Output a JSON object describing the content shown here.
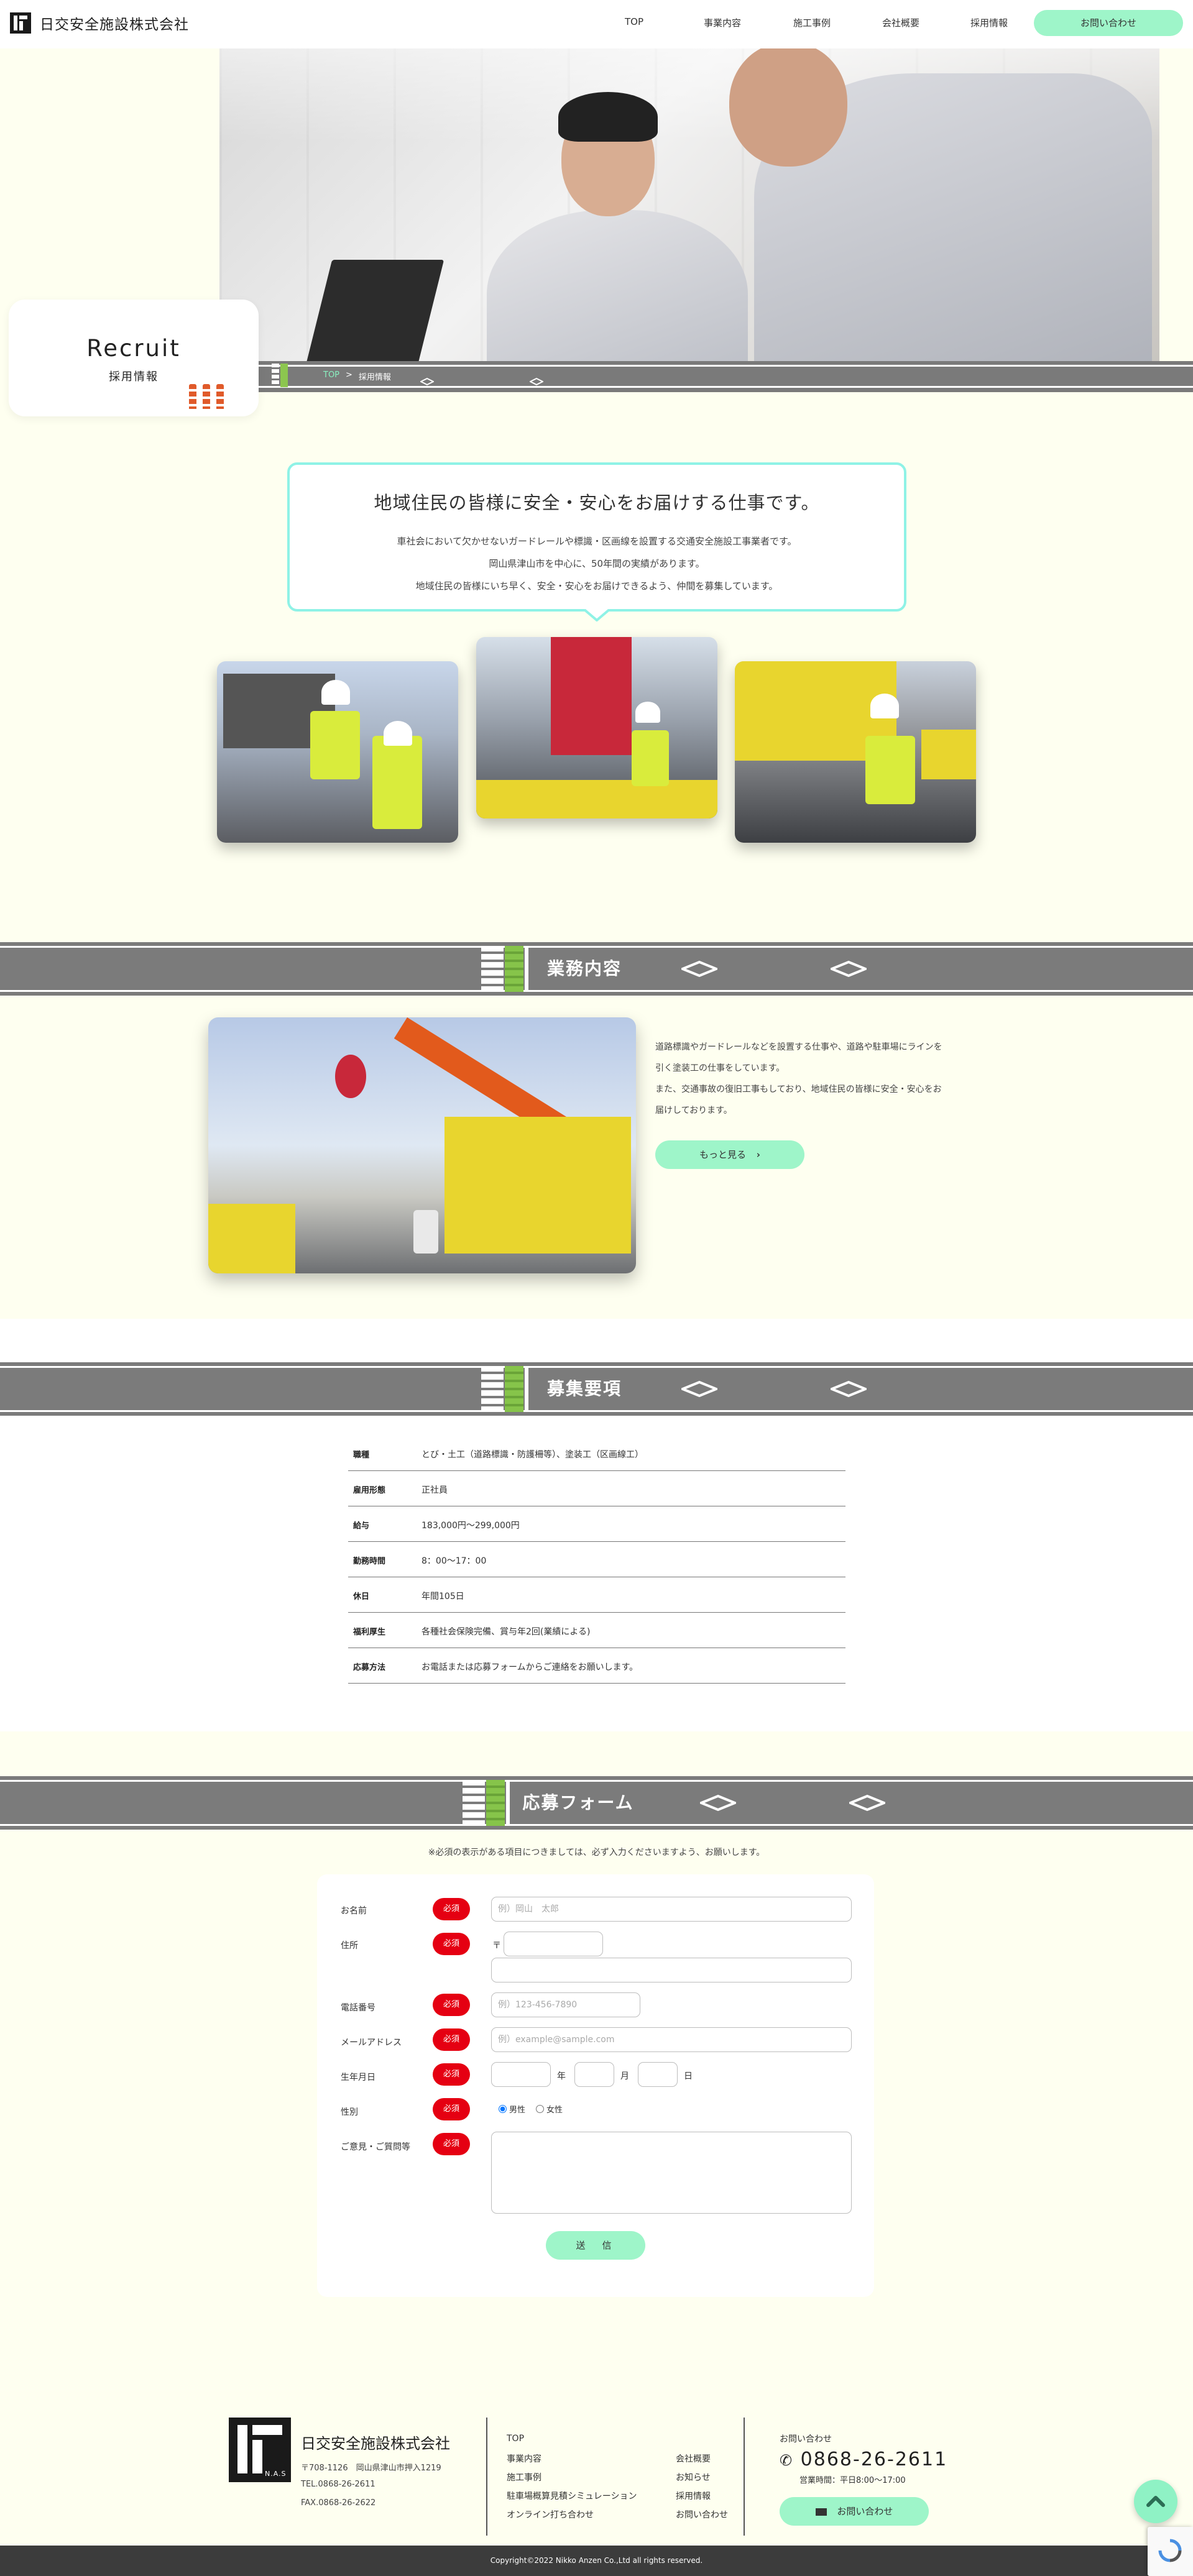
{
  "header": {
    "company": "日交安全施設株式会社",
    "nav": [
      "TOP",
      "事業内容",
      "施工事例",
      "会社概要",
      "採用情報"
    ],
    "contact_label": "お問い合わせ"
  },
  "hero": {
    "title_en": "Recruit",
    "title_jp": "採用情報",
    "breadcrumb_top": "TOP",
    "breadcrumb_sep": ">",
    "breadcrumb_current": "採用情報"
  },
  "intro": {
    "title": "地域住民の皆様に安全・安心をお届けする仕事です。",
    "lines": [
      "車社会において欠かせないガードレールや標識・区画線を設置する交通安全施設工事業者です。",
      "岡山県津山市を中心に、50年間の実績があります。",
      "地域住民の皆様にいち早く、安全・安心をお届けできるよう、仲間を募集しています。"
    ]
  },
  "business": {
    "heading": "業務内容",
    "text_lines": [
      "道路標識やガードレールなどを設置する仕事や、道路や駐車場にラインを",
      "引く塗装工の仕事をしています。",
      "また、交通事故の復旧工事もしており、地域住民の皆様に安全・安心をお",
      "届けしております。"
    ],
    "more_label": "もっと見る",
    "more_icon": "chevron-right-icon"
  },
  "requirements": {
    "heading": "募集要項",
    "rows": [
      {
        "label": "職種",
        "value": "とび・土工（道路標識・防護柵等）、塗装工（区画線工）"
      },
      {
        "label": "雇用形態",
        "value": "正社員"
      },
      {
        "label": "給与",
        "value": "183,000円〜299,000円"
      },
      {
        "label": "勤務時間",
        "value": "8：00〜17：00"
      },
      {
        "label": "休日",
        "value": "年間105日"
      },
      {
        "label": "福利厚生",
        "value": "各種社会保険完備、賞与年2回(業績による)"
      },
      {
        "label": "応募方法",
        "value": "お電話または応募フォームからご連絡をお願いします。"
      }
    ]
  },
  "form": {
    "heading": "応募フォーム",
    "note": "※必須の表示がある項目につきましては、必ず入力くださいますよう、お願いします。",
    "required_label": "必須",
    "name_label": "お名前",
    "name_placeholder": "例）岡山　太郎",
    "address_label": "住所",
    "postal_mark": "〒",
    "phone_label": "電話番号",
    "phone_placeholder": "例）123-456-7890",
    "email_label": "メールアドレス",
    "email_placeholder": "例）example@sample.com",
    "birth_label": "生年月日",
    "year_unit": "年",
    "month_unit": "月",
    "day_unit": "日",
    "gender_label": "性別",
    "gender_male": "男性",
    "gender_female": "女性",
    "gender_selected": "男性",
    "message_label": "ご意見・ご質問等",
    "submit_label": "送　信"
  },
  "footer": {
    "company": "日交安全施設株式会社",
    "logo_text": "N.A.S",
    "address_lines": [
      "〒708-1126　岡山県津山市押入1219",
      "TEL.0868-26-2611",
      "FAX.0868-26-2622"
    ],
    "links_col1": [
      "TOP",
      "事業内容",
      "施工事例",
      "駐車場概算見積シミュレーション",
      "オンライン打ち合わせ"
    ],
    "links_col2": [
      "会社概要",
      "お知らせ",
      "採用情報",
      "お問い合わせ"
    ],
    "contact_heading": "お問い合わせ",
    "phone": "0868-26-2611",
    "hours": "営業時間：平日8:00〜17:00",
    "contact_button": "お問い合わせ",
    "copyright": "Copyright©2022 Nikko Anzen Co.,Ltd all rights reserved."
  },
  "colors": {
    "accent_mint": "#9ef5c9",
    "required_red": "#e50012",
    "road_gray": "#7b7b7b",
    "page_cream": "#fefff0"
  }
}
